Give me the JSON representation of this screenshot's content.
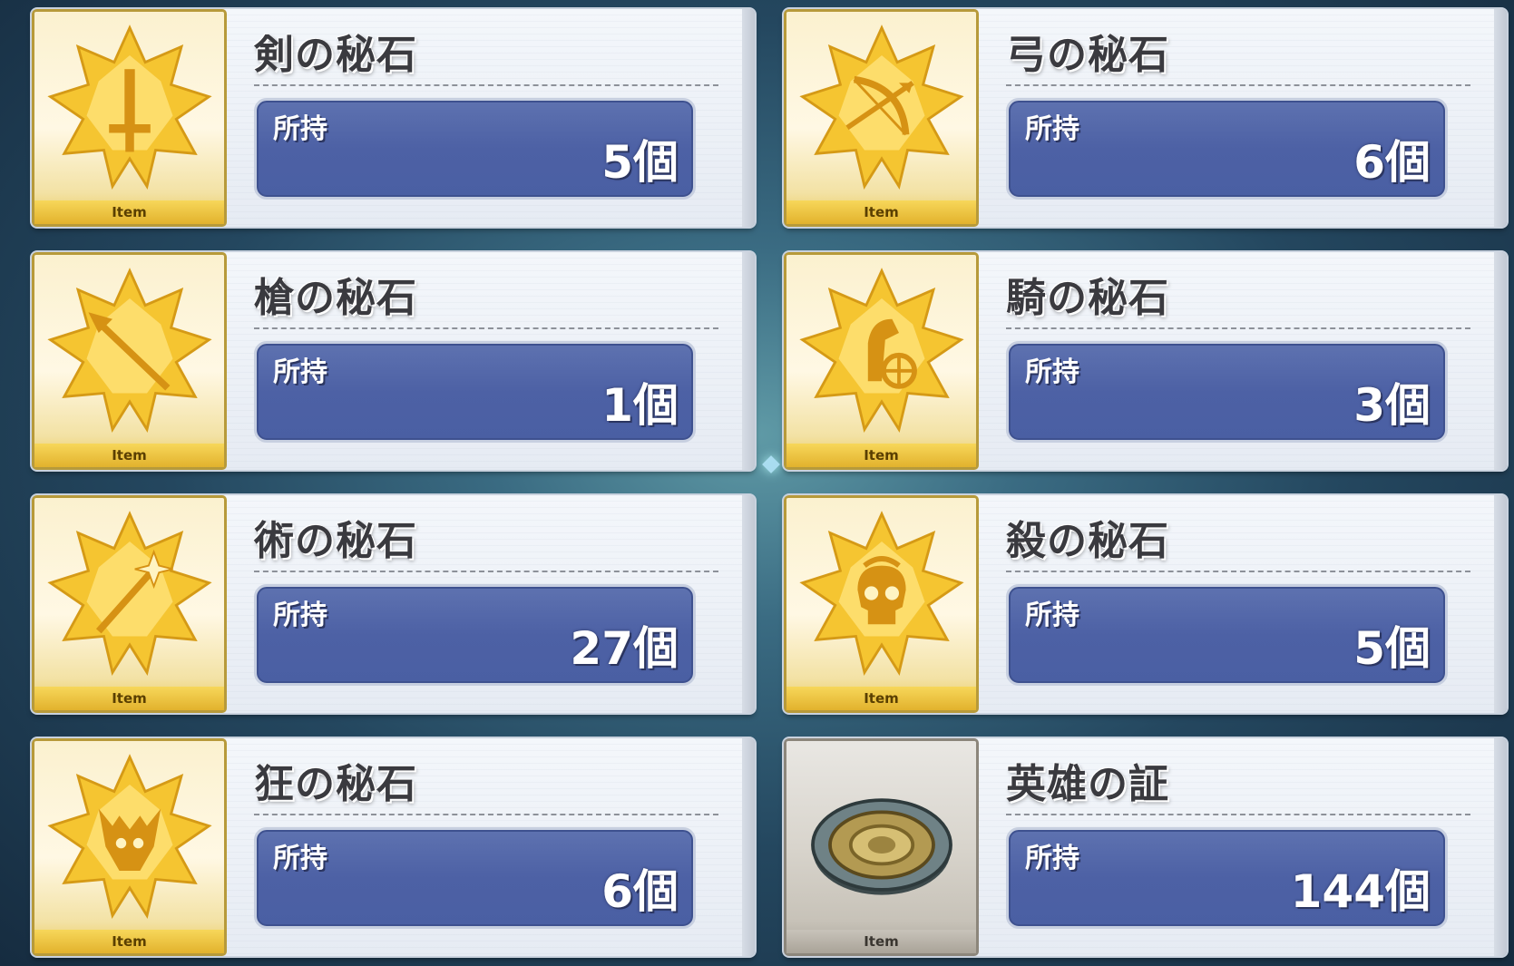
{
  "item_tag": "Item",
  "owned_label": "所持",
  "items": [
    {
      "name": "剣の秘石",
      "count": "5個",
      "icon": "saber-sword-icon",
      "type": "gold"
    },
    {
      "name": "弓の秘石",
      "count": "6個",
      "icon": "archer-bow-icon",
      "type": "gold"
    },
    {
      "name": "槍の秘石",
      "count": "1個",
      "icon": "lancer-spear-icon",
      "type": "gold"
    },
    {
      "name": "騎の秘石",
      "count": "3個",
      "icon": "rider-horse-icon",
      "type": "gold"
    },
    {
      "name": "術の秘石",
      "count": "27個",
      "icon": "caster-staff-icon",
      "type": "gold"
    },
    {
      "name": "殺の秘石",
      "count": "5個",
      "icon": "assassin-skull-icon",
      "type": "gold"
    },
    {
      "name": "狂の秘石",
      "count": "6個",
      "icon": "berserker-beast-icon",
      "type": "gold"
    },
    {
      "name": "英雄の証",
      "count": "144個",
      "icon": "hero-medal-icon",
      "type": "silver"
    }
  ],
  "colors": {
    "gold": "#f2c232",
    "panel_blue": "#4d61a5",
    "silver": "#c7c2b8"
  }
}
